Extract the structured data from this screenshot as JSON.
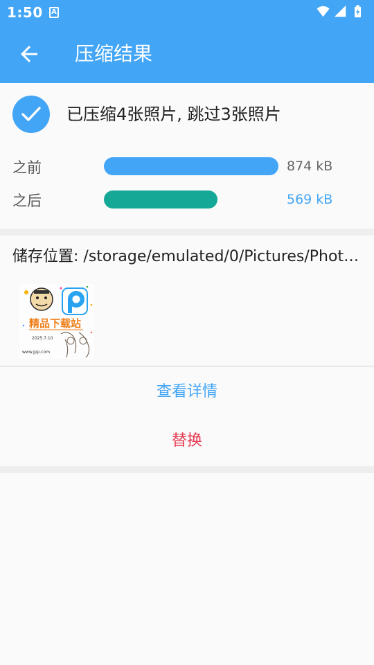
{
  "status_bar": {
    "time": "1:50",
    "notification_icon": "A"
  },
  "app_bar": {
    "title": "压缩结果",
    "back_icon": "arrow-back-icon"
  },
  "summary": {
    "text": "已压缩4张照片, 跳过3张照片",
    "icon": "check-circle-icon"
  },
  "comparison": {
    "before": {
      "label": "之前",
      "size": "874 kB",
      "fill_fraction": 1.0,
      "color": "#42a5f5",
      "text_color": "#666666"
    },
    "after": {
      "label": "之后",
      "size": "569 kB",
      "fill_fraction": 0.651,
      "color": "#16a896",
      "text_color": "#42a5f5"
    }
  },
  "storage": {
    "label": "储存位置: /storage/emulated/0/Pictures/Photo..."
  },
  "thumbnail": {
    "caption": "精品下载站",
    "date_text": "2025.7.10",
    "url_text": "www.jpp.com"
  },
  "actions": {
    "details_label": "查看详情",
    "details_color": "#42a5f5",
    "replace_label": "替换",
    "replace_color": "#e53950"
  },
  "colors": {
    "primary": "#42a5f5",
    "teal": "#16a896",
    "red": "#e53950"
  }
}
